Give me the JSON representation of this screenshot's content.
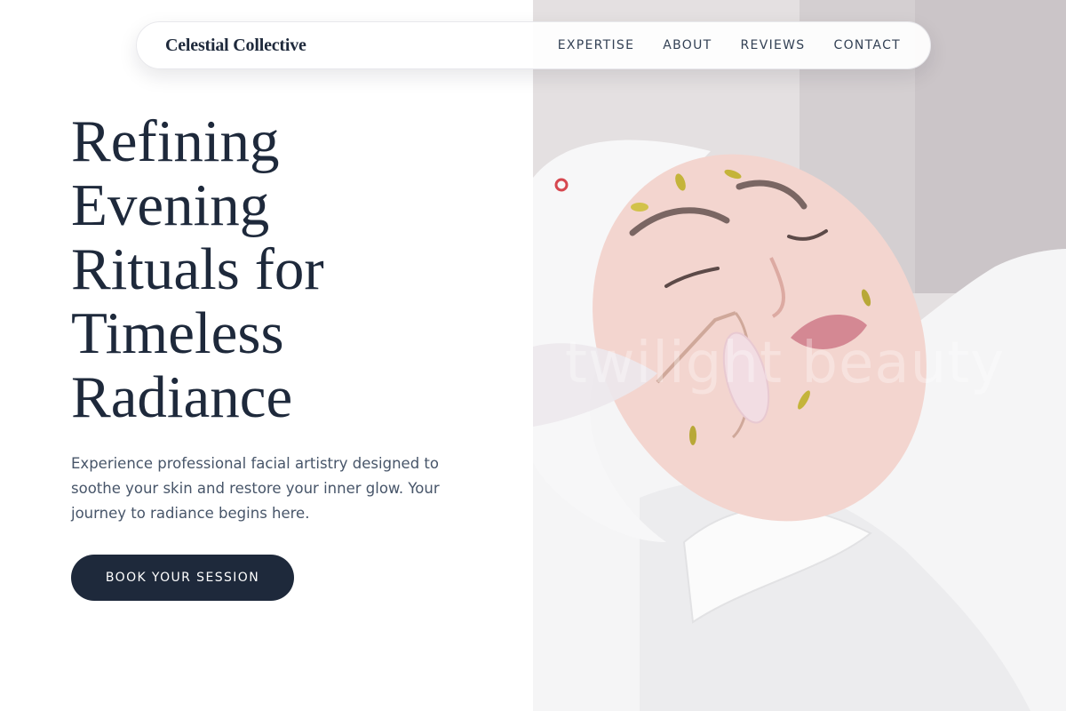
{
  "nav": {
    "brand": "Celestial Collective",
    "links": [
      "EXPERTISE",
      "ABOUT",
      "REVIEWS",
      "CONTACT"
    ]
  },
  "hero": {
    "title_lines": [
      "Refining",
      "Evening",
      "Rituals for",
      "Timeless",
      "Radiance"
    ],
    "description": "Experience professional facial artistry designed to soothe your skin and restore your inner glow. Your journey to radiance begins here.",
    "cta_label": "BOOK YOUR SESSION"
  },
  "image": {
    "watermark": "twilight beauty",
    "subject": "woman receiving facial treatment with jade roller"
  },
  "colors": {
    "primary": "#1e293b",
    "body_text": "#475569",
    "background": "#ffffff"
  }
}
